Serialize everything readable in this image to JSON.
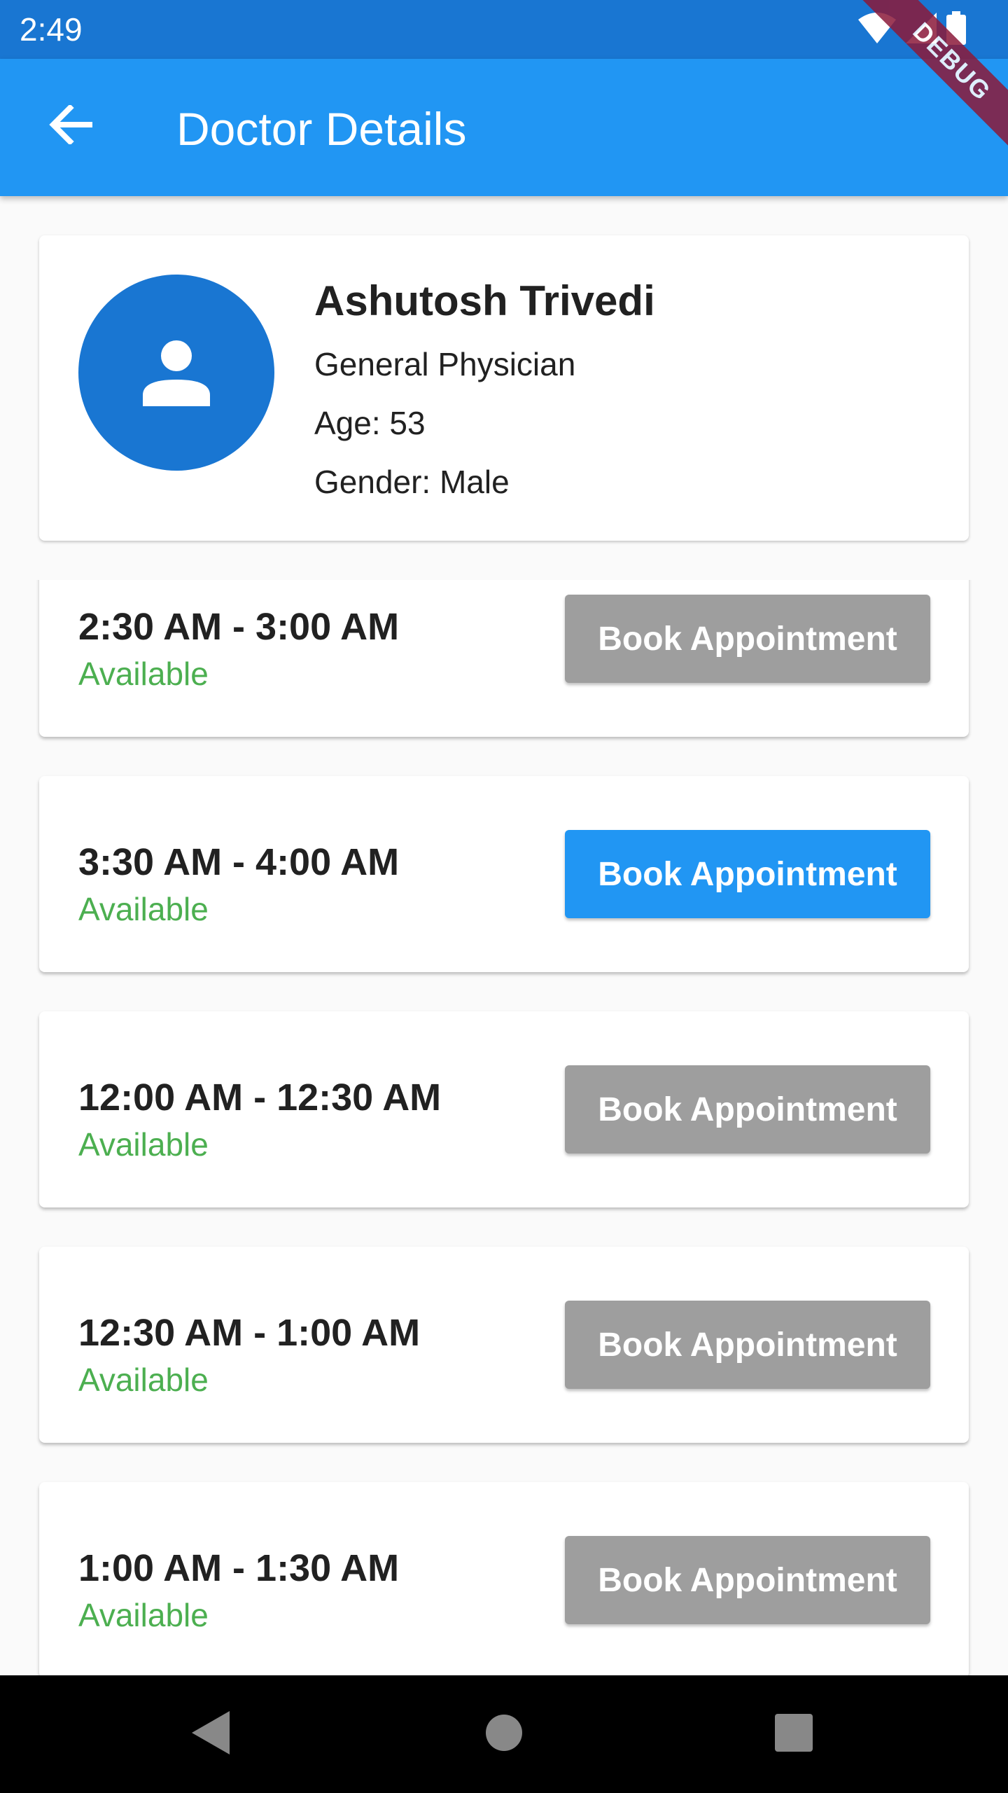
{
  "status_bar": {
    "time": "2:49"
  },
  "app_bar": {
    "title": "Doctor Details"
  },
  "debug_banner": "DEBUG",
  "doctor": {
    "name": "Ashutosh Trivedi",
    "specialty": "General Physician",
    "age": "Age: 53",
    "gender": "Gender: Male"
  },
  "slots": [
    {
      "time": "2:30 AM - 3:00 AM",
      "status": "Available",
      "button_label": "Book Appointment",
      "button_state": "disabled"
    },
    {
      "time": "3:30 AM - 4:00 AM",
      "status": "Available",
      "button_label": "Book Appointment",
      "button_state": "active"
    },
    {
      "time": "12:00 AM - 12:30 AM",
      "status": "Available",
      "button_label": "Book Appointment",
      "button_state": "disabled"
    },
    {
      "time": "12:30 AM - 1:00 AM",
      "status": "Available",
      "button_label": "Book Appointment",
      "button_state": "disabled"
    },
    {
      "time": "1:00 AM - 1:30 AM",
      "status": "Available",
      "button_label": "Book Appointment",
      "button_state": "disabled"
    }
  ],
  "colors": {
    "status_bar": "#1976d2",
    "app_bar": "#2196f3",
    "available": "#4caf50",
    "button_active": "#2196f3",
    "button_disabled": "#9e9e9e"
  },
  "icons": {
    "back": "arrow-back-icon",
    "avatar": "person-icon",
    "wifi": "wifi-icon",
    "signal": "signal-icon",
    "battery": "battery-icon",
    "nav_back": "triangle-back-icon",
    "nav_home": "circle-home-icon",
    "nav_recents": "square-recents-icon"
  }
}
